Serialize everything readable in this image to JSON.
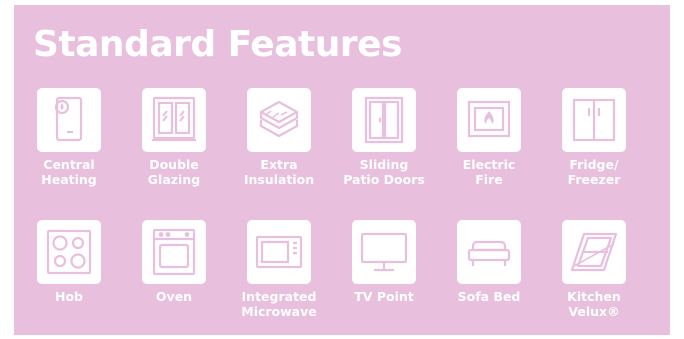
{
  "title": "Standard Features",
  "colors": {
    "background": "#e8bfdd",
    "icon": "#e8bfdd",
    "text": "#ffffff"
  },
  "features": [
    {
      "label": "Central\nHeating",
      "icon": "boiler-icon"
    },
    {
      "label": "Double\nGlazing",
      "icon": "double-window-icon"
    },
    {
      "label": "Extra\nInsulation",
      "icon": "insulation-layers-icon"
    },
    {
      "label": "Sliding\nPatio Doors",
      "icon": "patio-doors-icon"
    },
    {
      "label": "Electric\nFire",
      "icon": "electric-fire-icon"
    },
    {
      "label": "Fridge/\nFreezer",
      "icon": "fridge-freezer-icon"
    },
    {
      "label": "Hob",
      "icon": "hob-icon"
    },
    {
      "label": "Oven",
      "icon": "oven-icon"
    },
    {
      "label": "Integrated\nMicrowave",
      "icon": "microwave-icon"
    },
    {
      "label": "TV Point",
      "icon": "tv-icon"
    },
    {
      "label": "Sofa Bed",
      "icon": "sofa-bed-icon"
    },
    {
      "label": "Kitchen\nVelux®",
      "icon": "velux-window-icon"
    }
  ]
}
